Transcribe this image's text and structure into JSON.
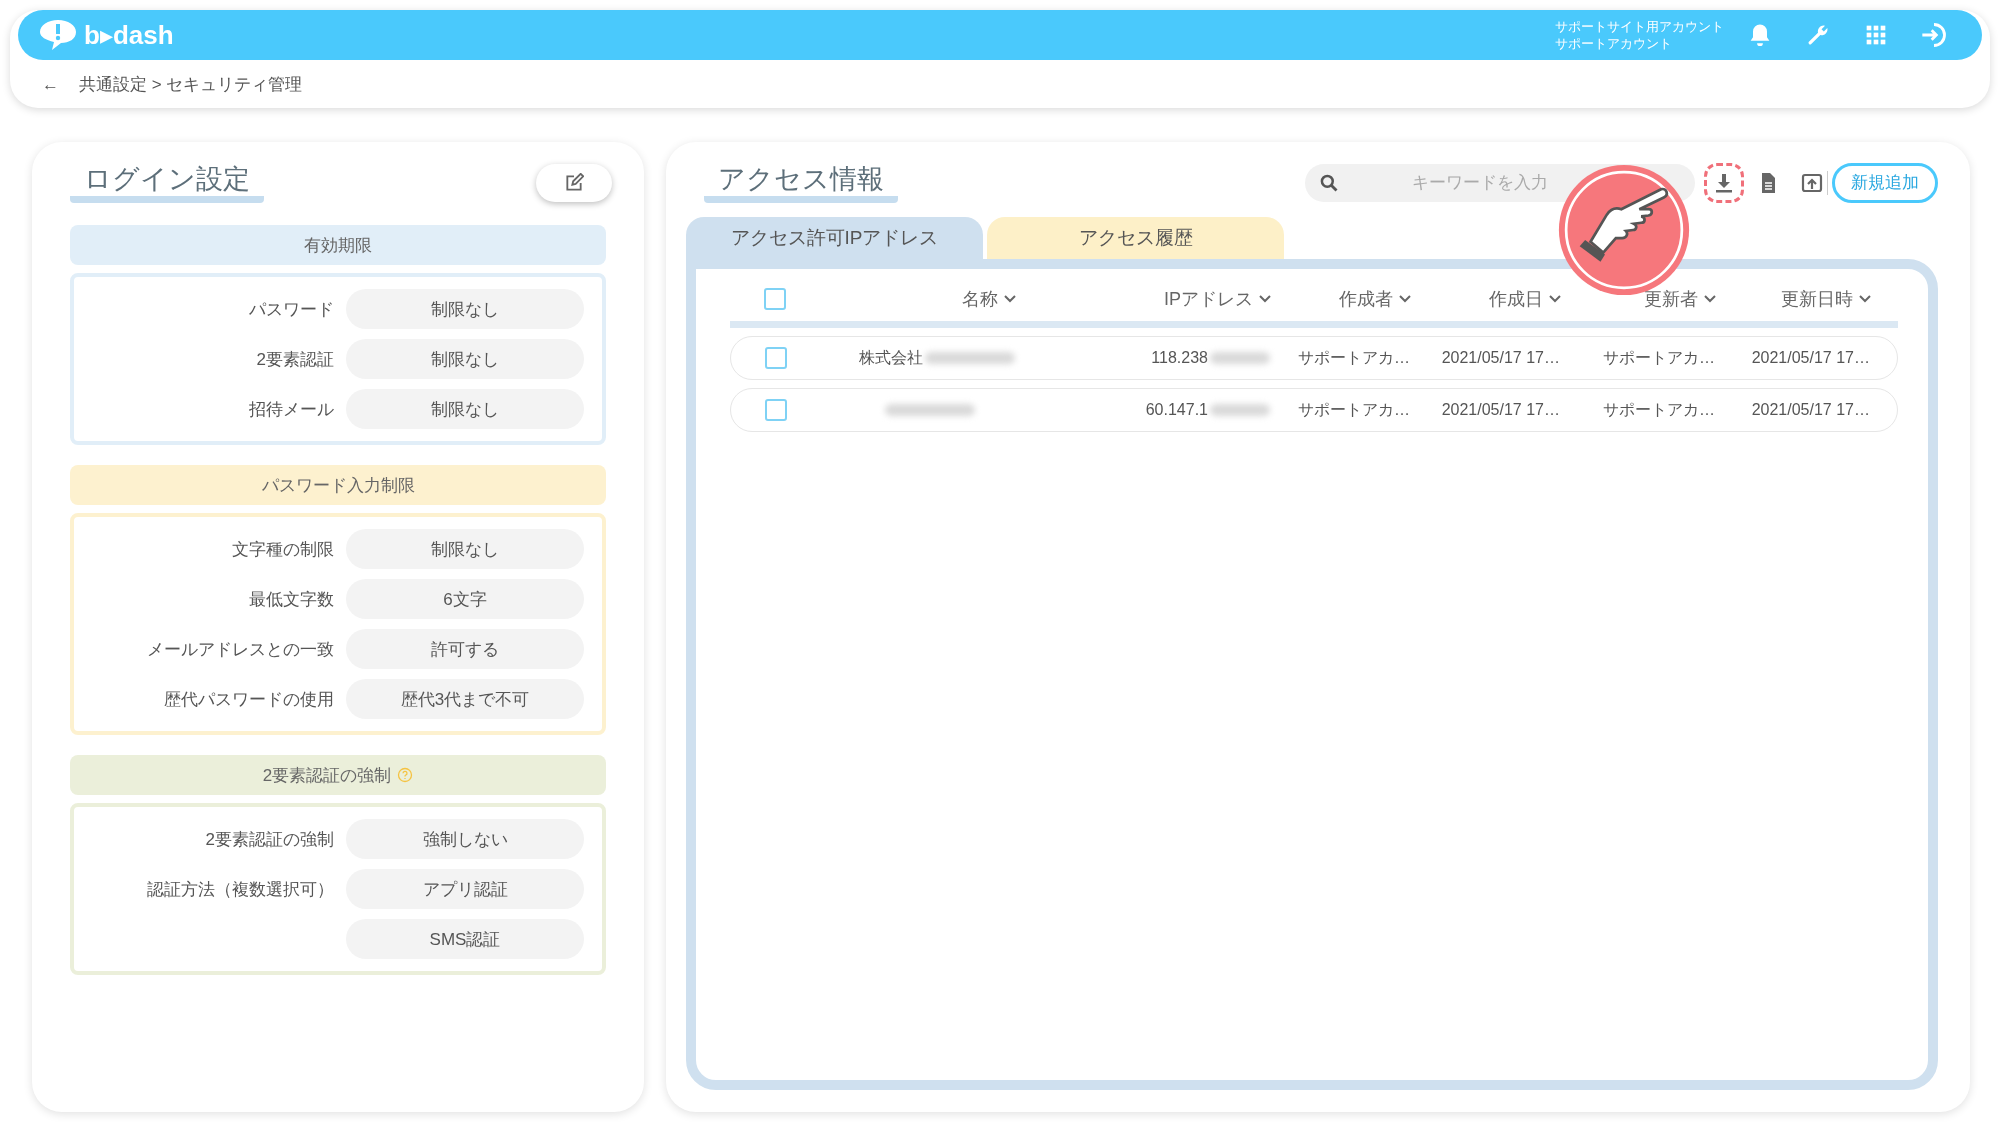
{
  "header": {
    "logo": "b▸dash",
    "account_lines": [
      "サポートサイト用アカウント",
      "サポートアカウント"
    ],
    "icons": [
      {
        "kind": "bell"
      },
      {
        "kind": "wrench"
      },
      {
        "kind": "grid"
      },
      {
        "kind": "logout"
      }
    ]
  },
  "breadcrumb": {
    "back": "←",
    "path": "共通設定 > セキュリティ管理"
  },
  "login_settings": {
    "title": "ログイン設定",
    "sections": [
      {
        "title": "有効期限",
        "color": "#e1eef8",
        "help": false,
        "rows": [
          {
            "label": "パスワード",
            "value": "制限なし"
          },
          {
            "label": "2要素認証",
            "value": "制限なし"
          },
          {
            "label": "招待メール",
            "value": "制限なし"
          }
        ]
      },
      {
        "title": "パスワード入力制限",
        "color": "#fdf1cf",
        "help": false,
        "rows": [
          {
            "label": "文字種の制限",
            "value": "制限なし"
          },
          {
            "label": "最低文字数",
            "value": "6文字"
          },
          {
            "label": "メールアドレスとの一致",
            "value": "許可する"
          },
          {
            "label": "歴代パスワードの使用",
            "value": "歴代3代まで不可"
          }
        ]
      },
      {
        "title": "2要素認証の強制",
        "color": "#ebefda",
        "help": true,
        "rows": [
          {
            "label": "2要素認証の強制",
            "value": "強制しない"
          },
          {
            "label": "認証方法（複数選択可）",
            "value": "アプリ認証"
          },
          {
            "value": "SMS認証"
          }
        ]
      }
    ]
  },
  "access_info": {
    "title": "アクセス情報",
    "search": {
      "placeholder": "キーワードを入力"
    },
    "toolbar": [
      {
        "kind": "download",
        "highlighted": true
      },
      {
        "kind": "document",
        "highlighted": false
      },
      {
        "kind": "export",
        "highlighted": false
      }
    ],
    "add_button": "新規追加",
    "tabs": [
      {
        "label": "アクセス許可IPアドレス",
        "selected": true
      },
      {
        "label": "アクセス履歴",
        "selected": false
      }
    ],
    "select_all": {
      "checked": false
    },
    "columns": [
      {
        "label": "名称"
      },
      {
        "label": "IPアドレス"
      },
      {
        "label": "作成者"
      },
      {
        "label": "作成日"
      },
      {
        "label": "更新者"
      },
      {
        "label": "更新日時"
      }
    ],
    "rows": [
      {
        "checked": false,
        "cells": [
          "株式会社",
          "118.238",
          "サポートアカ…",
          "2021/05/17 17…",
          "サポートアカ…",
          "2021/05/17 17…"
        ]
      },
      {
        "checked": false,
        "cells": [
          null,
          "60.147.1",
          "サポートアカ…",
          "2021/05/17 17…",
          "サポートアカ…",
          "2021/05/17 17…"
        ]
      }
    ]
  }
}
